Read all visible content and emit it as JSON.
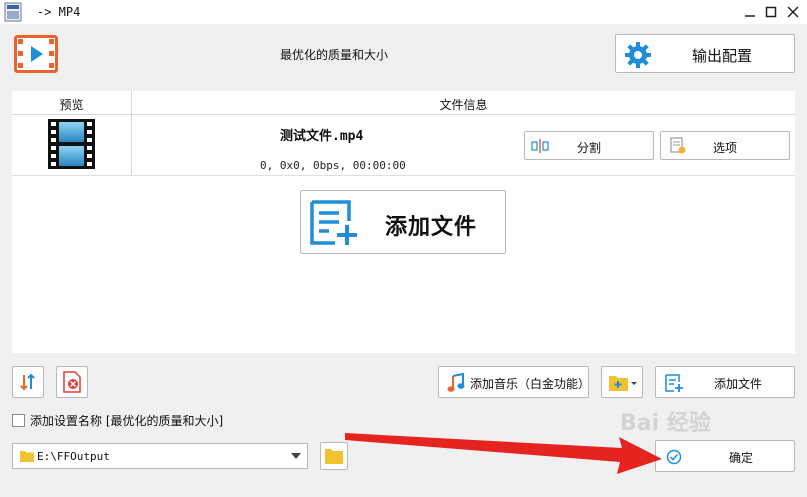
{
  "window": {
    "title": "-> MP4"
  },
  "header": {
    "profile_title": "最优化的质量和大小",
    "output_config_label": "输出配置"
  },
  "table": {
    "col_preview": "预览",
    "col_file_info": "文件信息",
    "file": {
      "name": "测试文件.mp4",
      "info": "0, 0x0, 0bps, 00:00:00"
    },
    "split_label": "分割",
    "options_label": "选项",
    "add_file_big_label": "添加文件"
  },
  "toolbar": {
    "add_music_label": "添加音乐（白金功能）",
    "add_file_label": "添加文件"
  },
  "settings": {
    "add_name_checkbox_label": "添加设置名称 [最优化的质量和大小]",
    "add_name_checked": false
  },
  "output": {
    "path": "E:\\FFOutput",
    "ok_label": "确定"
  },
  "watermark": "Bai 经验",
  "colors": {
    "accent": "#e8642c",
    "blue": "#1e8ed8",
    "red_arrow": "#e52420"
  }
}
